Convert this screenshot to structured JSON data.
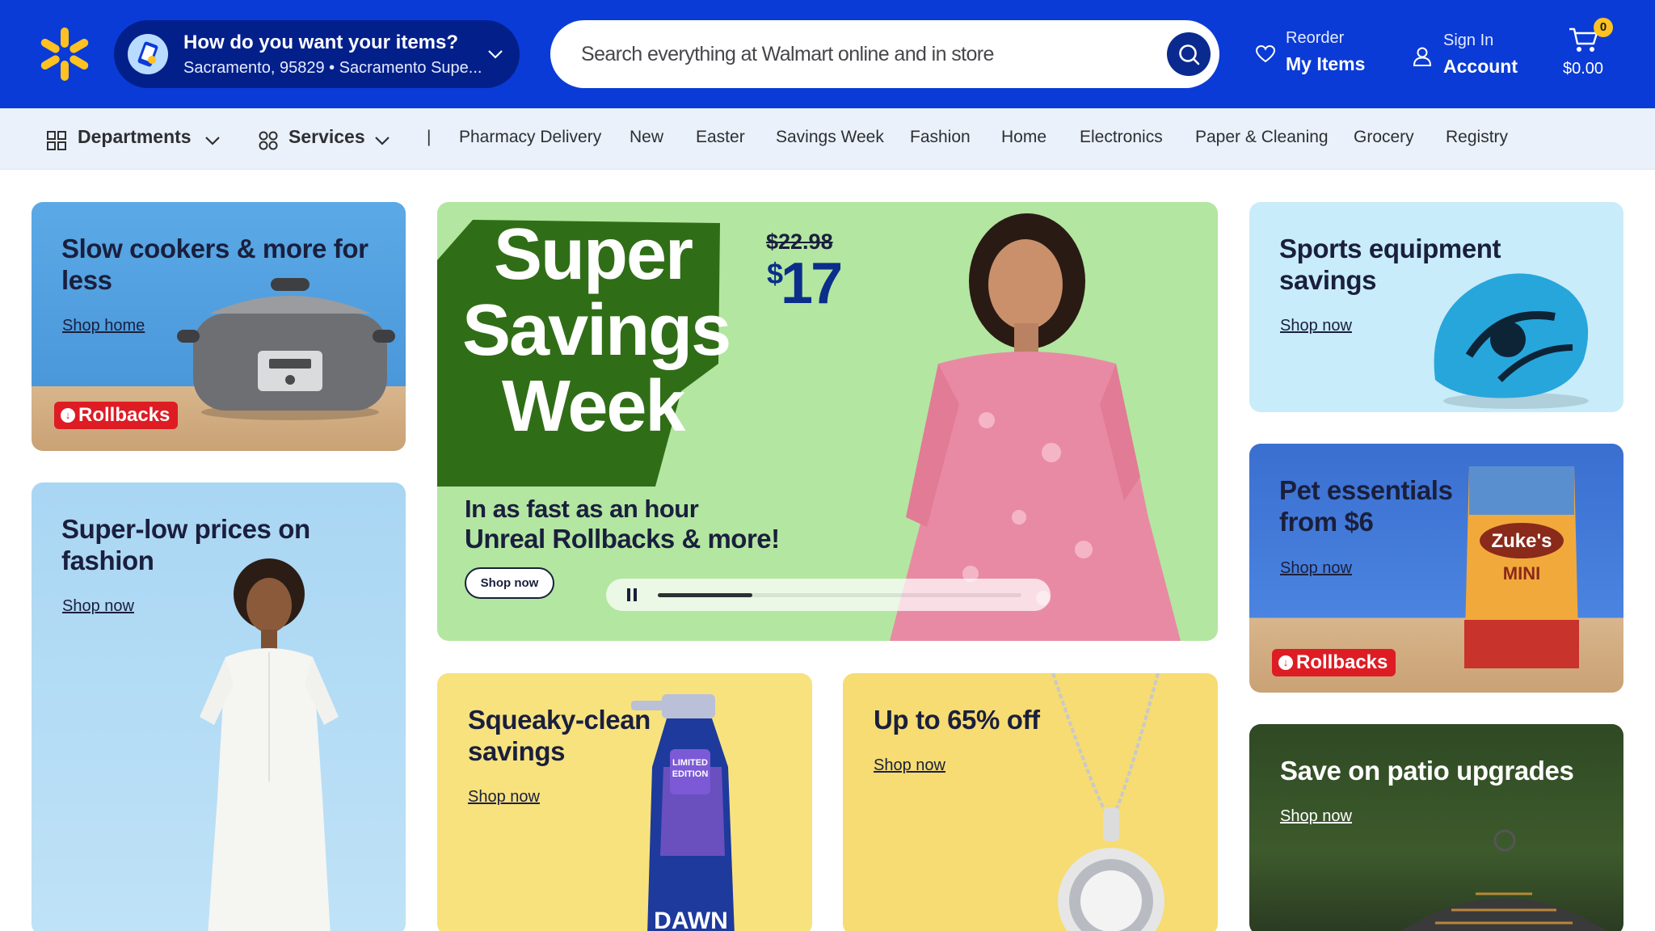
{
  "header": {
    "delivery_title": "How do you want your items?",
    "delivery_location": "Sacramento, 95829 • Sacramento Supe...",
    "search_placeholder": "Search everything at Walmart online and in store",
    "reorder_line1": "Reorder",
    "reorder_line2": "My Items",
    "signin_line1": "Sign In",
    "signin_line2": "Account",
    "cart_count": "0",
    "cart_total": "$0.00"
  },
  "subnav": {
    "departments": "Departments",
    "services": "Services",
    "divider": "|",
    "links": [
      "Pharmacy Delivery",
      "New",
      "Easter",
      "Savings Week",
      "Fashion",
      "Home",
      "Electronics",
      "Paper & Cleaning",
      "Grocery",
      "Registry"
    ]
  },
  "cards": {
    "slow_cookers": {
      "title": "Slow cookers & more for less",
      "link": "Shop home",
      "badge": "Rollbacks"
    },
    "fashion": {
      "title": "Super-low prices on fashion",
      "link": "Shop now"
    },
    "hero": {
      "headline_1": "Super",
      "headline_2": "Savings",
      "headline_3": "Week",
      "price_was": "$22.98",
      "price_now_symbol": "$",
      "price_now": "17",
      "line_1": "In as fast as an hour",
      "line_2": "Unreal Rollbacks & more!",
      "button": "Shop now",
      "progress": 0.26
    },
    "squeaky": {
      "title": "Squeaky-clean savings",
      "link": "Shop now"
    },
    "jewelry": {
      "title": "Up to 65% off",
      "link": "Shop now"
    },
    "sports": {
      "title": "Sports equipment savings",
      "link": "Shop now"
    },
    "pet": {
      "title": "Pet essentials from $6",
      "link": "Shop now",
      "badge": "Rollbacks"
    },
    "patio": {
      "title": "Save on patio upgrades",
      "link": "Shop now"
    }
  },
  "colors": {
    "brand_blue": "#0b3bd6",
    "spark_yellow": "#ffc220",
    "rollback_red": "#de1c24"
  }
}
